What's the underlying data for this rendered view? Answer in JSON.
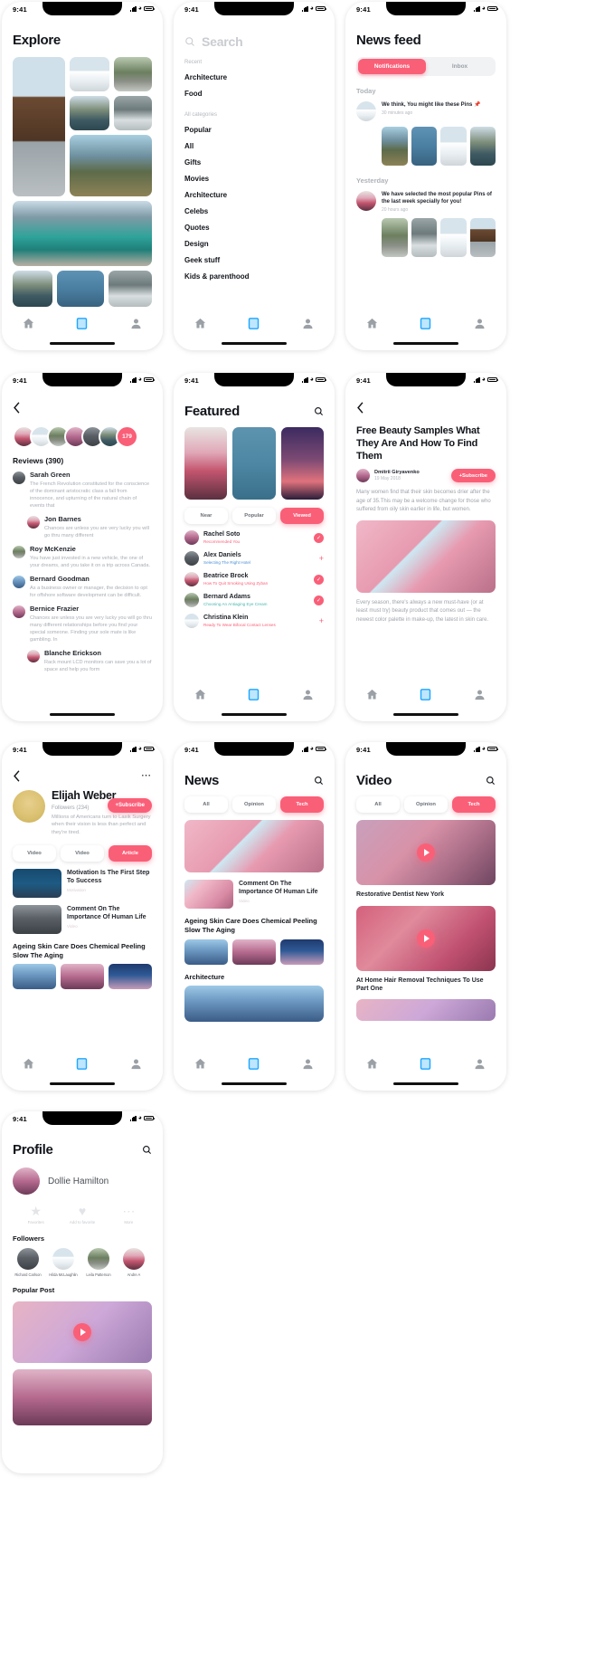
{
  "status_bar": {
    "time": "9:41"
  },
  "screens": {
    "explore": {
      "title": "Explore"
    },
    "search": {
      "placeholder": "Search",
      "recent_label": "Recent",
      "recent": [
        "Architecture",
        "Food"
      ],
      "all_label": "All categories",
      "categories": [
        "Popular",
        "All",
        "Gifts",
        "Movies",
        "Architecture",
        "Celebs",
        "Quotes",
        "Design",
        "Geek stuff",
        "Kids & parenthood"
      ]
    },
    "newsfeed": {
      "title": "News feed",
      "tabs": [
        {
          "label": "Notifications",
          "active": true
        },
        {
          "label": "Inbox",
          "active": false
        }
      ],
      "sections": [
        {
          "heading": "Today",
          "text": "We think, You might like these Pins 📌",
          "time": "30 minutes ago"
        },
        {
          "heading": "Yesterday",
          "text": "We have selected the most popular Pins of the last week specially for you!",
          "time": "20 hours ago"
        }
      ]
    },
    "reviews": {
      "back_icon": "chevron-left-icon",
      "avatar_more_count": "179",
      "title": "Reviews (390)",
      "items": [
        {
          "name": "Sarah Green",
          "text": "The French Revolution constituted for the conscience of the dominant aristocratic class a fall from innocence, and upturning of the natural chain of events that",
          "nested": {
            "name": "Jon Barnes",
            "text": "Chances are unless you are very lucky you will go thru many different"
          }
        },
        {
          "name": "Roy McKenzie",
          "text": "You have just invested in a new vehicle, the one of your dreams, and you take it on a trip across Canada."
        },
        {
          "name": "Bernard Goodman",
          "text": "As a business owner or manager, the decision to opt for offshore software development can be difficult."
        },
        {
          "name": "Bernice Frazier",
          "text": "Chances are unless you are very lucky you will go thru many different relationships before you find your special someone. Finding your sole mate is like gambling. In",
          "nested": {
            "name": "Blanche Erickson",
            "text": "Rack mount LCD monitors can save you a lot of space and help you form"
          }
        }
      ]
    },
    "featured": {
      "title": "Featured",
      "search_icon": "search-icon",
      "chips": [
        {
          "label": "Near",
          "active": false
        },
        {
          "label": "Popular",
          "active": false
        },
        {
          "label": "Viewed",
          "active": true
        }
      ],
      "people": [
        {
          "name": "Rachel Soto",
          "subtitle": "Recommended You",
          "subtitle_color": "#fa5f78",
          "action": "check"
        },
        {
          "name": "Alex Daniels",
          "subtitle": "Selecting The Right Hotel",
          "subtitle_color": "#4a8fd6",
          "action": "plus"
        },
        {
          "name": "Beatrice Brock",
          "subtitle": "How To Quit Smoking Using Zyban",
          "subtitle_color": "#fa5f78",
          "action": "check"
        },
        {
          "name": "Bernard Adams",
          "subtitle": "Choosing An Antiaging Eye Cream",
          "subtitle_color": "#4ab8b0",
          "action": "check"
        },
        {
          "name": "Christina Klein",
          "subtitle": "Ready To Wear Bifocal Contact Lenses",
          "subtitle_color": "#fa5f78",
          "action": "plus"
        }
      ]
    },
    "article": {
      "back_icon": "chevron-left-icon",
      "title": "Free Beauty Samples What They Are And How To Find Them",
      "author": "Dmitrii Giryavenko",
      "date": "19 May 2018",
      "subscribe_label": "+Subscribe",
      "paragraph_1": "Many women find that their skin becomes drier after the age of 35.This may be a welcome change for those who suffered from oily skin earlier in life, but women.",
      "paragraph_2": "Every season, there's always a new must-have (or at least must try) beauty product that comes out — the newest color palette in make-up, the latest in skin care."
    },
    "author_profile": {
      "back_icon": "chevron-left-icon",
      "more_icon": "more-horizontal-icon",
      "name": "Elijah Weber",
      "followers": "Followers (234)",
      "bio": "Millions of Americans turn to Lasik Surgery when their vision is less than perfect and they're tired.",
      "chips": [
        {
          "label": "Video",
          "active": false
        },
        {
          "label": "Video",
          "active": false
        },
        {
          "label": "Article",
          "active": true
        }
      ],
      "items": [
        {
          "title": "Motivation Is The First Step To Success",
          "tag": "Motivation"
        },
        {
          "title": "Comment On The Importance Of Human Life",
          "tag": "Video"
        }
      ],
      "section_title": "Ageing Skin Care Does Chemical Peeling Slow The Aging"
    },
    "news": {
      "title": "News",
      "search_icon": "search-icon",
      "chips": [
        {
          "label": "All",
          "active": false
        },
        {
          "label": "Opinion",
          "active": false
        },
        {
          "label": "Tech",
          "active": true
        }
      ],
      "items": [
        {
          "title": "Comment On The Importance Of Human Life",
          "tag": "Video"
        }
      ],
      "section_title": "Ageing Skin Care Does Chemical Peeling Slow The Aging",
      "section_title_2": "Architecture"
    },
    "video": {
      "title": "Video",
      "search_icon": "search-icon",
      "chips": [
        {
          "label": "All",
          "active": false
        },
        {
          "label": "Opinion",
          "active": false
        },
        {
          "label": "Tech",
          "active": true
        }
      ],
      "items": [
        {
          "caption": "Restorative Dentist New York"
        },
        {
          "caption": "At Home Hair Removal Techniques To Use Part One"
        }
      ]
    },
    "profile": {
      "title": "Profile",
      "search_icon": "search-icon",
      "name": "Dollie Hamilton",
      "actions": [
        {
          "label": "Favorites",
          "icon": "star-icon"
        },
        {
          "label": "Add to favorite",
          "icon": "heart-icon"
        },
        {
          "label": "More",
          "icon": "more-horizontal-icon"
        }
      ],
      "followers_label": "Followers",
      "followers": [
        "Richard Carlson",
        "Hilda McLaughlin",
        "Leila Patterson",
        "Andre A"
      ],
      "popular_label": "Popular Post"
    }
  },
  "tabbar": {
    "items": [
      {
        "name": "home-icon",
        "active": false
      },
      {
        "name": "feed-icon",
        "active": true
      },
      {
        "name": "profile-icon",
        "active": false
      }
    ]
  },
  "colors": {
    "accent": "#fa5f78",
    "tab_active": "#1ea7ff",
    "text": "#11141a",
    "muted": "#a9aeb5"
  }
}
